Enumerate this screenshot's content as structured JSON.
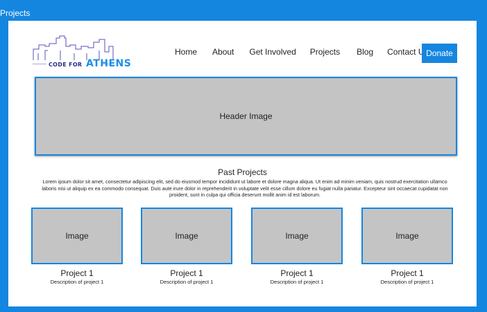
{
  "window": {
    "title": "Projects"
  },
  "logo": {
    "line1": "CODE FOR",
    "line2": "ATHENS"
  },
  "nav": {
    "items": [
      "Home",
      "About",
      "Get Involved",
      "Projects",
      "Blog",
      "Contact Us"
    ],
    "donate_label": "Donate"
  },
  "header": {
    "image_label": "Header Image"
  },
  "past_projects": {
    "title": "Past Projects",
    "body": "Lorem ipsum dolor sit amet, consectetur adipiscing elit, sed do eiusmod tempor incididunt ut labore et dolore magna aliqua. Ut enim ad minim veniam, quis nostrud exercitation ullamco laboris nisi ut aliquip ex ea commodo consequat. Duis aute irure dolor in reprehenderit in voluptate velit esse cillum dolore eu fugiat nulla pariatur. Excepteur sint occaecat cupidatat non proident, sunt in culpa qui officia deserunt mollit anim id est laborum.",
    "cards": [
      {
        "image_label": "Image",
        "title": "Project 1",
        "description": "Description of project 1"
      },
      {
        "image_label": "Image",
        "title": "Project 1",
        "description": "Description of project 1"
      },
      {
        "image_label": "Image",
        "title": "Project 1",
        "description": "Description of project 1"
      },
      {
        "image_label": "Image",
        "title": "Project 1",
        "description": "Description of project 1"
      }
    ]
  },
  "colors": {
    "accent": "#1586e0",
    "placeholder": "#c4c4c4",
    "logo_navy": "#2b2f8a"
  }
}
